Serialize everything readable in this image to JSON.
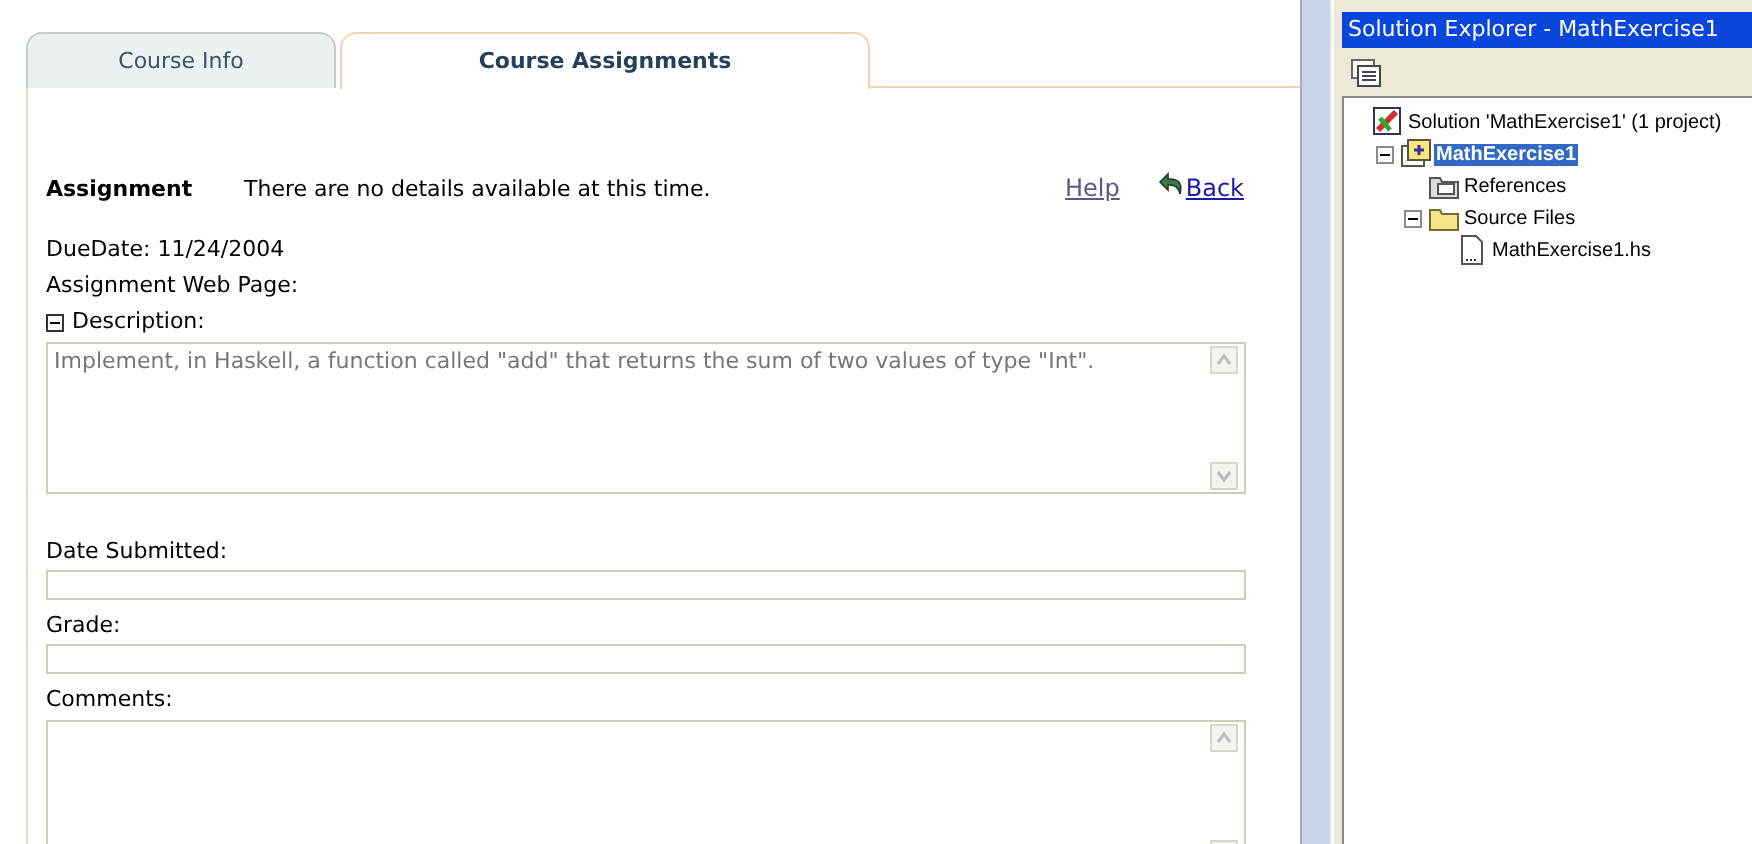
{
  "tabs": [
    {
      "label": "Course Info",
      "selected": false
    },
    {
      "label": "Course Assignments",
      "selected": true
    }
  ],
  "assignment": {
    "heading": "Assignment",
    "message": "There are no details available at this time.",
    "help_link": "Help",
    "back_link": "Back"
  },
  "due_date": "DueDate: 11/24/2004",
  "web_page_label": "Assignment Web Page:",
  "description": {
    "label": "Description:",
    "expanded": true,
    "value": "Implement, in Haskell, a function called \"add\" that returns the sum of two values of type \"Int\"."
  },
  "fields": [
    {
      "label": "Date Submitted:",
      "kind": "line"
    },
    {
      "label": "Grade:",
      "kind": "line"
    },
    {
      "label": "Comments:",
      "kind": "area"
    }
  ],
  "solution_explorer": {
    "title": "Solution Explorer - MathExercise1",
    "tree": [
      {
        "label": "Solution 'MathExercise1' (1 project)",
        "kind": "solution",
        "selected": false,
        "children": [
          {
            "label": "MathExercise1",
            "kind": "project",
            "selected": true,
            "expanded": true,
            "children": [
              {
                "label": "References",
                "kind": "references",
                "selected": false
              },
              {
                "label": "Source Files",
                "kind": "folder",
                "selected": false,
                "expanded": true,
                "children": [
                  {
                    "label": "MathExercise1.hs",
                    "kind": "file",
                    "selected": false
                  }
                ]
              }
            ]
          }
        ]
      }
    ]
  }
}
